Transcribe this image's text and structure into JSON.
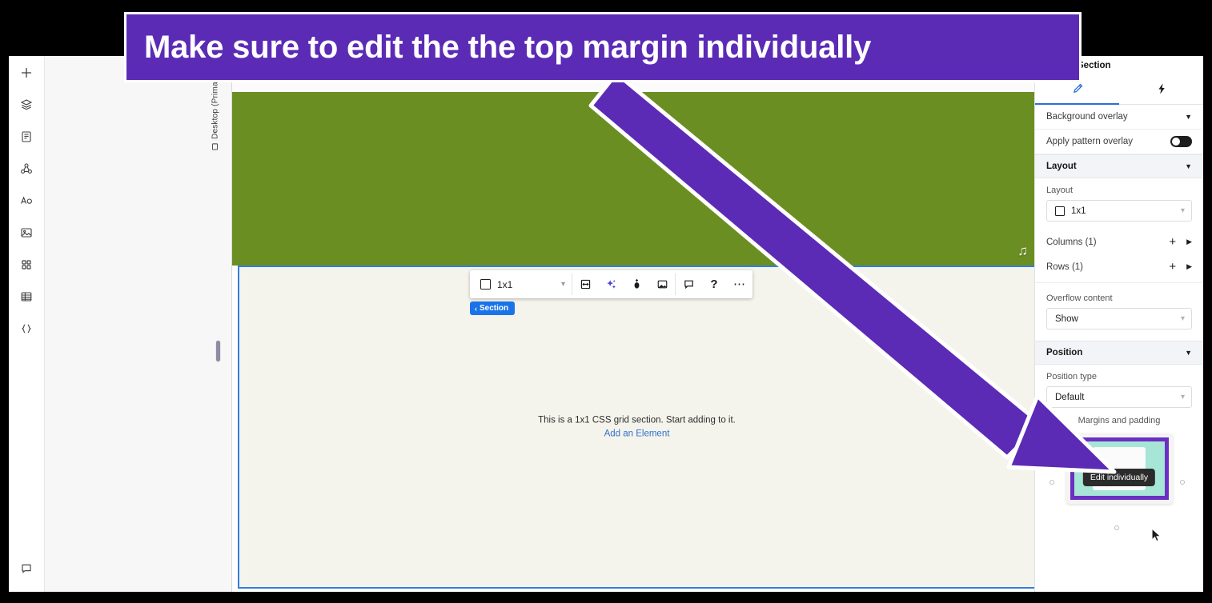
{
  "annotation": {
    "banner_text": "Make sure to edit the the top margin individually",
    "banner_bg": "#5B2BB5",
    "banner_border": "#FFFFFF",
    "arrow_color": "#5B2BB5",
    "arrow_outline": "#FFFFFF"
  },
  "left_rail": {
    "items": [
      {
        "name": "add-icon",
        "glyph": "plus"
      },
      {
        "name": "layers-icon",
        "glyph": "layers"
      },
      {
        "name": "page-icon",
        "glyph": "page"
      },
      {
        "name": "components-icon",
        "glyph": "components"
      },
      {
        "name": "typography-icon",
        "glyph": "typography"
      },
      {
        "name": "media-icon",
        "glyph": "media"
      },
      {
        "name": "apps-icon",
        "glyph": "apps"
      },
      {
        "name": "cms-icon",
        "glyph": "cms"
      },
      {
        "name": "code-icon",
        "glyph": "code"
      }
    ],
    "bottom_item": {
      "name": "comments-icon",
      "glyph": "comment"
    }
  },
  "canvas": {
    "device_label": "Desktop (Primary)",
    "section_pill": "Section",
    "element_toolbar": {
      "layout_value": "1x1",
      "buttons": [
        {
          "name": "stretch-icon",
          "label": "stretch"
        },
        {
          "name": "ai-sparkle-icon",
          "label": "ai"
        },
        {
          "name": "animation-icon",
          "label": "animate"
        },
        {
          "name": "background-icon",
          "label": "background"
        },
        {
          "name": "comment-icon",
          "label": "comment"
        },
        {
          "name": "help-icon",
          "label": "?"
        },
        {
          "name": "more-options-icon",
          "label": "..."
        }
      ]
    },
    "grid_section": {
      "empty_text": "This is a 1x1 CSS grid section. Start adding to it.",
      "add_link": "Add an Element",
      "selection_color": "#2F7FE0",
      "fill_color": "#F5F4EC"
    },
    "hero": {
      "play_badge": "play-badge",
      "music_icon": "♫"
    }
  },
  "right_panel": {
    "title": "Section",
    "tabs": [
      {
        "name": "tab-style",
        "icon": "paintbrush",
        "active": true
      },
      {
        "name": "tab-interactions",
        "icon": "lightning",
        "active": false
      }
    ],
    "rows": {
      "background_overlay": "Background overlay",
      "apply_pattern_overlay": "Apply pattern overlay"
    },
    "layout_section": {
      "header": "Layout",
      "layout_label": "Layout",
      "layout_value": "1x1",
      "columns_label": "Columns (1)",
      "rows_label": "Rows (1)",
      "overflow_label": "Overflow content",
      "overflow_value": "Show"
    },
    "position_section": {
      "header": "Position",
      "position_type_label": "Position type",
      "position_type_value": "Default"
    },
    "spacing_section": {
      "label": "Margins and padding",
      "tooltip": "Edit individually",
      "margin_color": "#6B2FC2",
      "padding_color": "#A5E6D6"
    }
  }
}
